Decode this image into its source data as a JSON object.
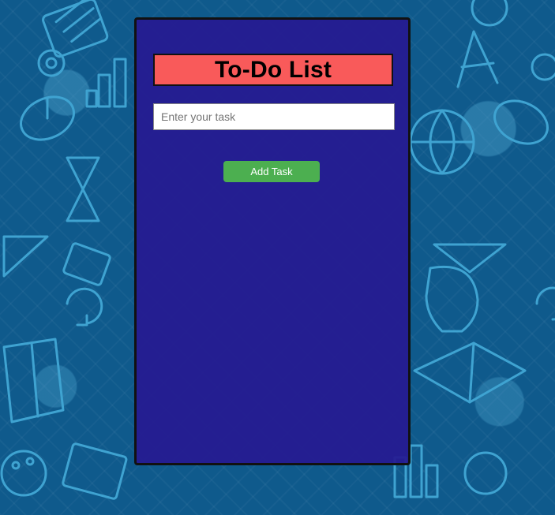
{
  "app": {
    "title": "To-Do List"
  },
  "task_input": {
    "value": "",
    "placeholder": "Enter your task"
  },
  "add_button": {
    "label": "Add Task"
  },
  "tasks": [],
  "colors": {
    "background": "#0f5a8c",
    "panel": "#261a91",
    "title_box": "#f95a5a",
    "add_button": "#4caf50"
  },
  "icons": {
    "background": "education-doodle-pattern"
  }
}
